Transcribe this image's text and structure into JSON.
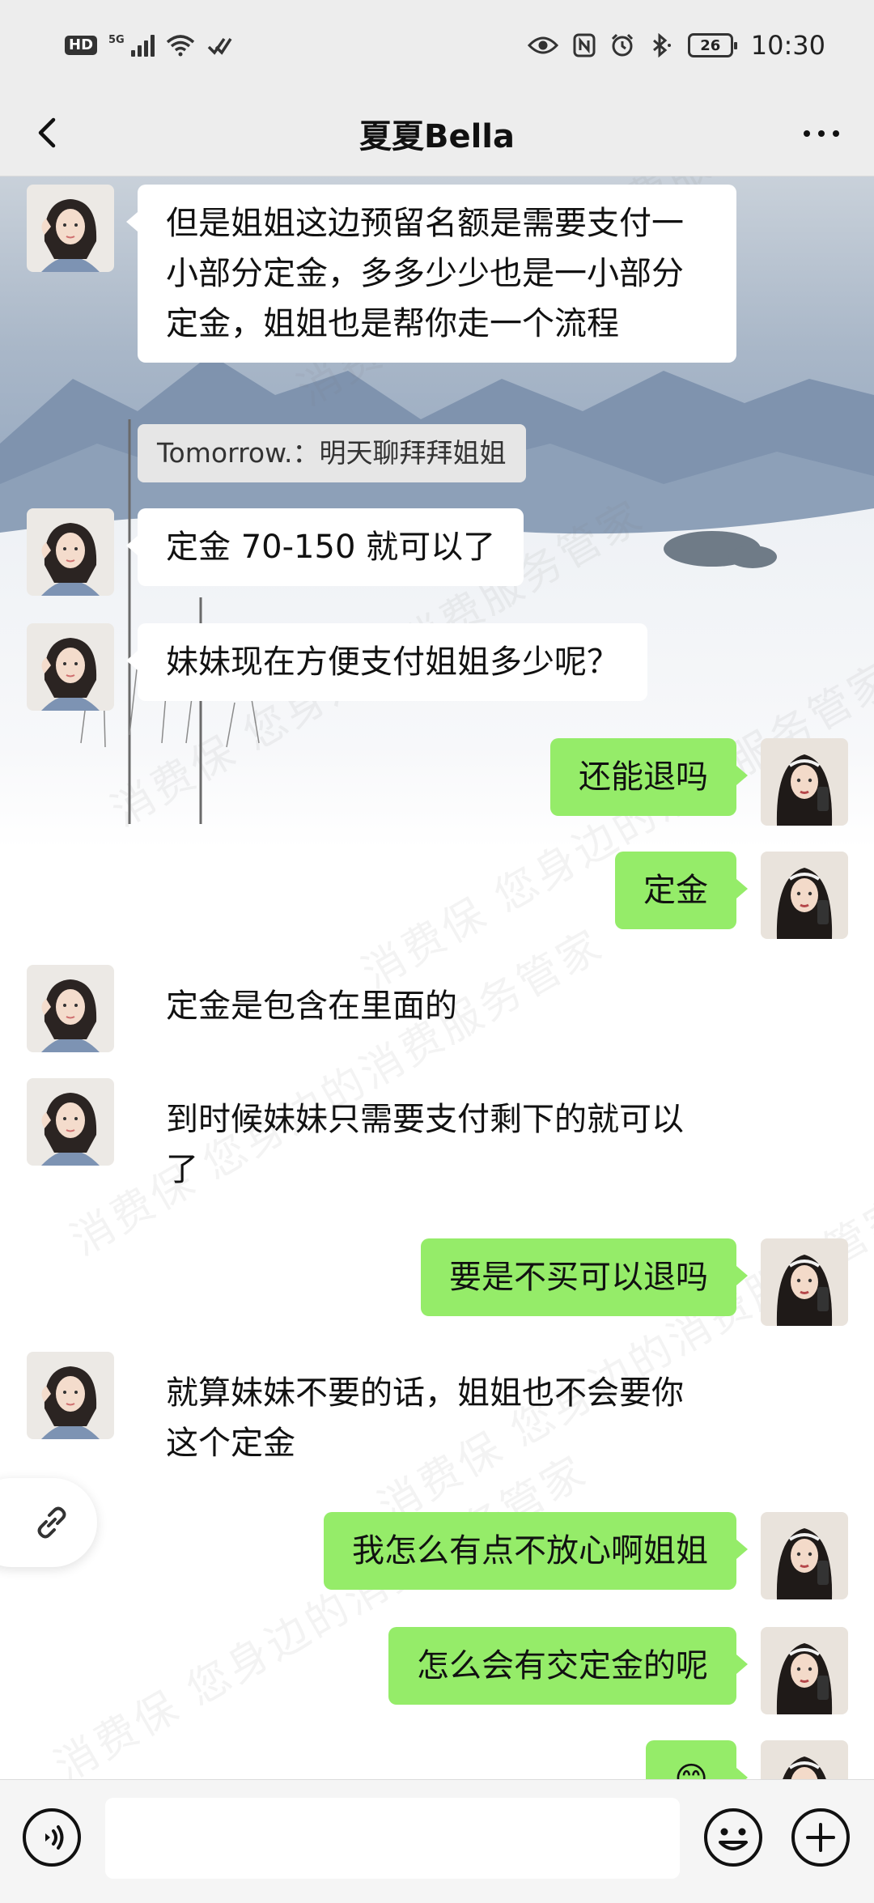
{
  "status_bar": {
    "hd_label": "HD",
    "network_label": "5G",
    "battery": "26",
    "time": "10:30"
  },
  "header": {
    "title": "夏夏Bella",
    "back_icon": "chevron-left-icon",
    "more_icon": "more-dots-icon"
  },
  "quote": {
    "text": "Tomorrow.：明天聊拜拜姐姐"
  },
  "messages": [
    {
      "side": "left",
      "style": "bubble",
      "text": "但是姐姐这边预留名额是需要支付一小部分定金，多多少少也是一小部分定金，姐姐也是帮你走一个流程"
    },
    {
      "side": "left",
      "style": "bubble",
      "text": "定金 70-150 就可以了"
    },
    {
      "side": "left",
      "style": "bubble",
      "text": "妹妹现在方便支付姐姐多少呢？"
    },
    {
      "side": "right",
      "style": "bubble",
      "text": "还能退吗"
    },
    {
      "side": "right",
      "style": "bubble",
      "text": "定金"
    },
    {
      "side": "left",
      "style": "plain",
      "text": "定金是包含在里面的"
    },
    {
      "side": "left",
      "style": "plain",
      "text": "到时候妹妹只需要支付剩下的就可以了"
    },
    {
      "side": "right",
      "style": "bubble",
      "text": "要是不买可以退吗"
    },
    {
      "side": "left",
      "style": "plain",
      "text": "就算妹妹不要的话，姐姐也不会要你这个定金"
    },
    {
      "side": "right",
      "style": "bubble",
      "text": "我怎么有点不放心啊姐姐"
    },
    {
      "side": "right",
      "style": "bubble",
      "text": "怎么会有交定金的呢"
    },
    {
      "side": "right",
      "style": "bubble",
      "text": "😊"
    }
  ],
  "watermark_text": "消费保 您身边的消费服务管家",
  "input_bar": {
    "placeholder": "",
    "voice_icon": "voice-icon",
    "emoji_icon": "emoji-icon",
    "plus_icon": "plus-icon"
  },
  "colors": {
    "header_bg": "#ededed",
    "sent_bubble": "#95ec69",
    "received_bubble": "#ffffff",
    "quote_bg": "#e6e6e6"
  }
}
